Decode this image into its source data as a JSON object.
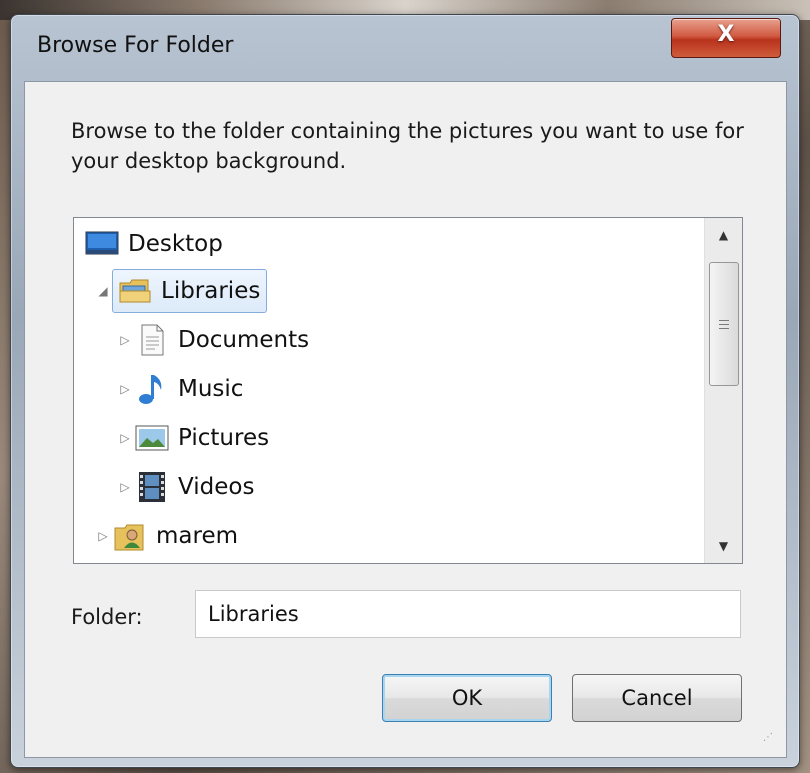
{
  "window": {
    "title": "Browse For Folder",
    "close_label": "X"
  },
  "description": "Browse to the folder containing the pictures you want to use for your desktop background.",
  "tree": {
    "items": [
      {
        "label": "Desktop",
        "icon": "desktop-icon",
        "expander": ""
      },
      {
        "label": "Libraries",
        "icon": "libraries-folder-icon",
        "expander": "◢",
        "selected": true
      },
      {
        "label": "Documents",
        "icon": "document-icon",
        "expander": "▷"
      },
      {
        "label": "Music",
        "icon": "music-note-icon",
        "expander": "▷"
      },
      {
        "label": "Pictures",
        "icon": "picture-icon",
        "expander": "▷"
      },
      {
        "label": "Videos",
        "icon": "film-icon",
        "expander": "▷"
      },
      {
        "label": "marem",
        "icon": "user-folder-icon",
        "expander": "▷"
      }
    ]
  },
  "folder": {
    "label": "Folder:",
    "value": "Libraries"
  },
  "buttons": {
    "ok": "OK",
    "cancel": "Cancel"
  },
  "colors": {
    "accent": "#3c7fb1",
    "close": "#c8402a",
    "selection": "#dceaf9"
  }
}
